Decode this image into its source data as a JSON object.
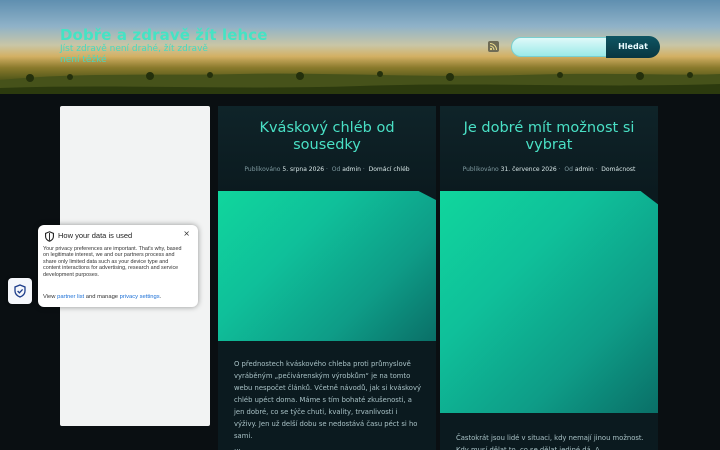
{
  "header": {
    "site_title": "Dobře a zdravě žít lehce",
    "tagline": "Jíst zdravě není drahé, žít zdravě není těžké",
    "rss_icon": "rss-icon",
    "search": {
      "value": "",
      "placeholder": "",
      "button_label": "Hledat"
    }
  },
  "posts": [
    {
      "title": "Kváskový chléb od sousedky",
      "meta": {
        "published_label": "Publikováno",
        "date": "5. srpna 2026",
        "by_label": "Od",
        "author": "admin",
        "category": "Domácí chléb"
      },
      "excerpt": "O přednostech kváskového chleba proti průmyslově vyráběným „pečivárenským výrobkům“ je na tomto webu nespočet článků. Včetně návodů, jak si kváskový chléb upéct doma. Máme s tím bohaté zkušenosti, a jen dobré, co se týče chuti, kvality, trvanlivosti i výživy. Jen už delší dobu se nedostává času péct si ho sami.",
      "more": "…"
    },
    {
      "title": "Je dobré mít možnost si vybrat",
      "meta": {
        "published_label": "Publikováno",
        "date": "31. července 2026",
        "by_label": "Od",
        "author": "admin",
        "category": "Domácnost"
      },
      "excerpt": "Častokrát jsou lidé v situaci, kdy nemají jinou možnost. Kdy musí dělat to, co se dělat jediné dá. A"
    }
  ],
  "privacy": {
    "title": "How your data is used",
    "body": "Your privacy preferences are important. That's why, based on legitimate interest, we and our partners process and share only limited data such as your device type and content interactions for advertising, research and service development purposes.",
    "links_prefix": "View",
    "partner_link": "partner list",
    "links_middle": "and manage",
    "privacy_link": "privacy settings",
    "links_suffix": ".",
    "close": "×"
  },
  "colors": {
    "accent": "#49e0c5",
    "page_bg": "#0a0f12",
    "card_bg": "#0b1a1f",
    "thumb": "#10d69d"
  }
}
